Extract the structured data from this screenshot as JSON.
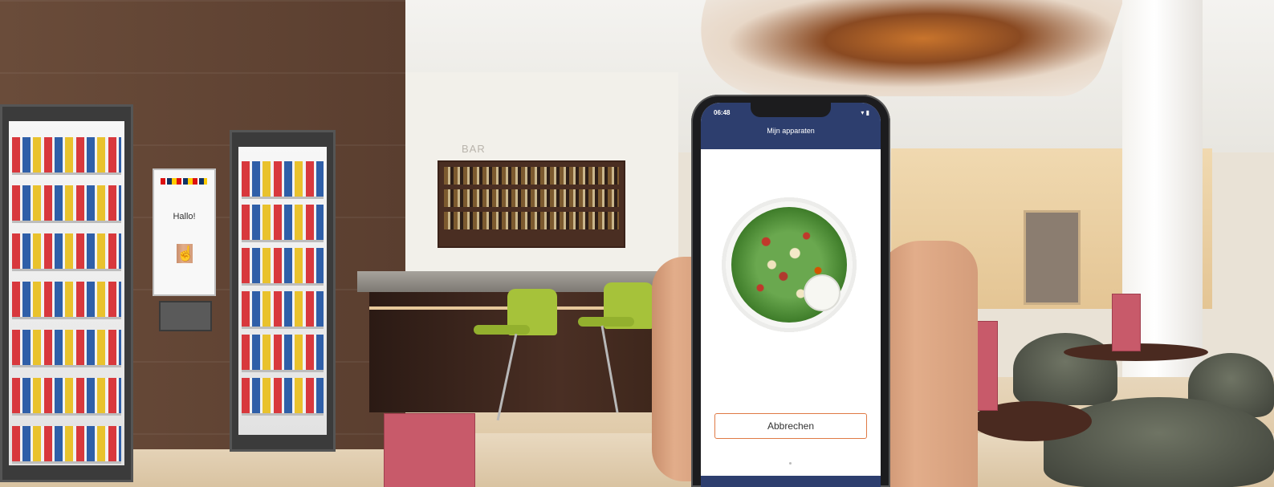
{
  "scene": {
    "bar_sign": "BAR",
    "kiosk": {
      "greeting": "Hallo!"
    }
  },
  "phone": {
    "status_time": "06:48",
    "status_icons": "▾ ▮",
    "header_title": "Mijn apparaten",
    "cancel_button_label": "Abbrechen"
  },
  "colors": {
    "phone_header": "#2d3e6e",
    "cancel_border": "#e07a45",
    "stool_green": "#a6c23a"
  }
}
